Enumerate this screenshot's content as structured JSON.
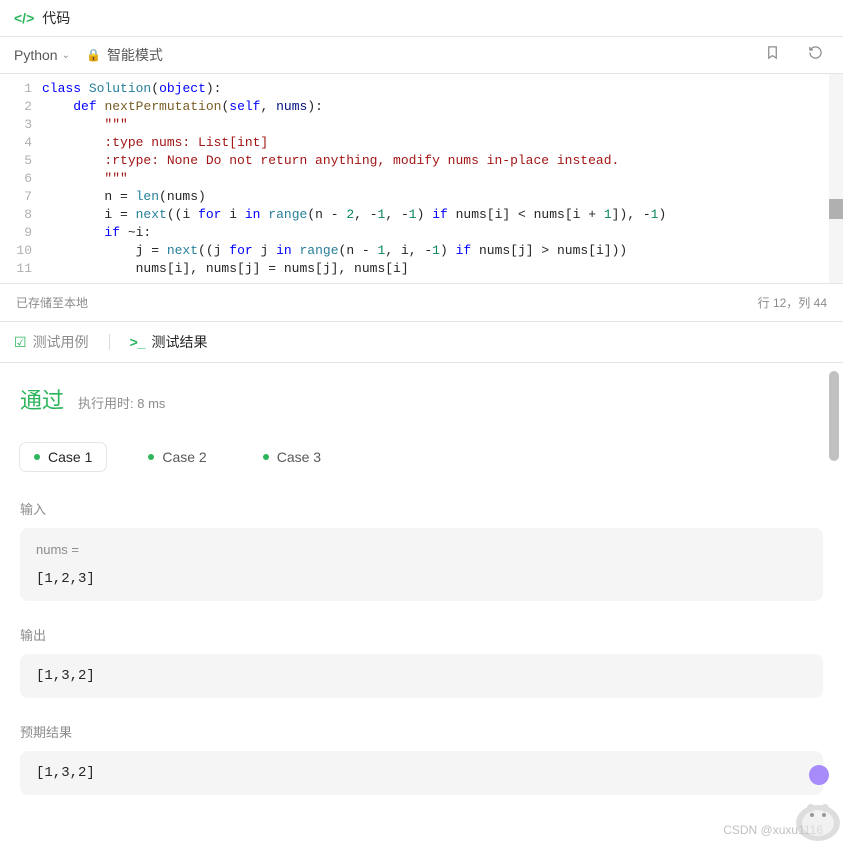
{
  "header": {
    "title": "代码"
  },
  "toolbar": {
    "language": "Python",
    "mode_label": "智能模式"
  },
  "editor": {
    "lines": [
      {
        "n": 1,
        "html": "<span class='kw'>class</span> <span class='cls'>Solution</span>(<span class='obj'>object</span>):"
      },
      {
        "n": 2,
        "html": "    <span class='kw'>def</span> <span class='fn'>nextPermutation</span>(<span class='self'>self</span>, <span class='param'>nums</span>):"
      },
      {
        "n": 3,
        "html": "        <span class='str'>\"\"\"</span>"
      },
      {
        "n": 4,
        "html": "<span class='str'>        :type nums: List[int]</span>"
      },
      {
        "n": 5,
        "html": "<span class='str'>        :rtype: None Do not return anything, modify nums in-place instead.</span>"
      },
      {
        "n": 6,
        "html": "<span class='str'>        \"\"\"</span>"
      },
      {
        "n": 7,
        "html": "        n = <span class='builtin'>len</span>(nums)"
      },
      {
        "n": 8,
        "html": "        i = <span class='builtin'>next</span>((i <span class='kw'>for</span> i <span class='kw'>in</span> <span class='builtin'>range</span>(n - <span class='num'>2</span>, -<span class='num'>1</span>, -<span class='num'>1</span>) <span class='kw'>if</span> nums[i] &lt; nums[i + <span class='num'>1</span>]), -<span class='num'>1</span>)"
      },
      {
        "n": 9,
        "html": "        <span class='kw'>if</span> ~i:"
      },
      {
        "n": 10,
        "html": "            j = <span class='builtin'>next</span>((j <span class='kw'>for</span> j <span class='kw'>in</span> <span class='builtin'>range</span>(n - <span class='num'>1</span>, i, -<span class='num'>1</span>) <span class='kw'>if</span> nums[j] &gt; nums[i]))"
      },
      {
        "n": 11,
        "html": "            nums[i], nums[j] = nums[j], nums[i]"
      }
    ]
  },
  "status": {
    "saved": "已存储至本地",
    "cursor": "行 12，列 44"
  },
  "tabs": {
    "test_cases": "测试用例",
    "test_results": "测试结果"
  },
  "results": {
    "pass_label": "通过",
    "exec_time": "执行用时: 8 ms",
    "cases": [
      {
        "label": "Case 1",
        "active": true
      },
      {
        "label": "Case 2",
        "active": false
      },
      {
        "label": "Case 3",
        "active": false
      }
    ],
    "input": {
      "label": "输入",
      "var": "nums =",
      "value": "[1,2,3]"
    },
    "output": {
      "label": "输出",
      "value": "[1,3,2]"
    },
    "expected": {
      "label": "预期结果",
      "value": "[1,3,2]"
    }
  },
  "watermark": "CSDN @xuxu1116"
}
